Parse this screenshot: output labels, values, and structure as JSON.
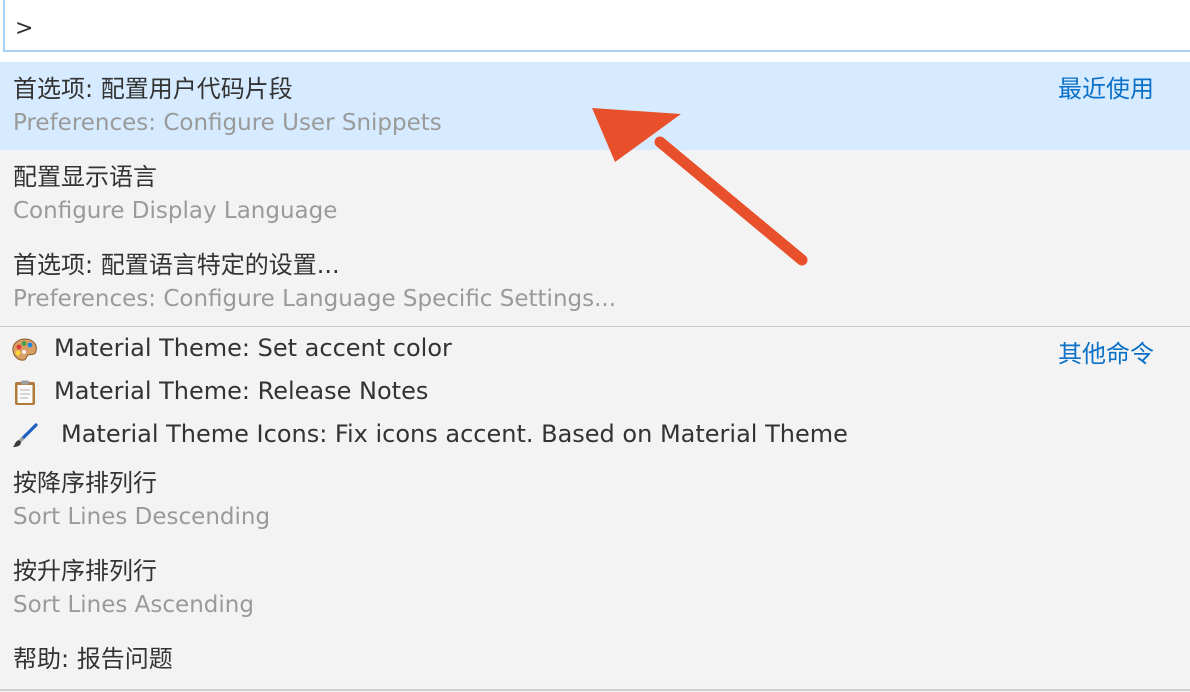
{
  "search": {
    "value": ">"
  },
  "items": [
    {
      "label": "首选项: 配置用户代码片段",
      "detail": "Preferences: Configure User Snippets",
      "badge": "最近使用",
      "selected": true
    },
    {
      "label": "配置显示语言",
      "detail": "Configure Display Language"
    },
    {
      "label": "首选项: 配置语言特定的设置...",
      "detail": "Preferences: Configure Language Specific Settings..."
    },
    {
      "label": "Material Theme: Set accent color",
      "icon": "palette-icon",
      "badge": "其他命令"
    },
    {
      "label": "Material Theme: Release Notes",
      "icon": "clipboard-icon"
    },
    {
      "label": "Material Theme Icons: Fix icons accent. Based on Material Theme",
      "icon": "paintbrush-icon"
    },
    {
      "label": "按降序排列行",
      "detail": "Sort Lines Descending"
    },
    {
      "label": "按升序排列行",
      "detail": "Sort Lines Ascending"
    },
    {
      "label": "帮助: 报告问题"
    }
  ],
  "colors": {
    "selected_background": "#d6ebff",
    "badge": "#0b70c7",
    "arrow": "#e8502b"
  }
}
